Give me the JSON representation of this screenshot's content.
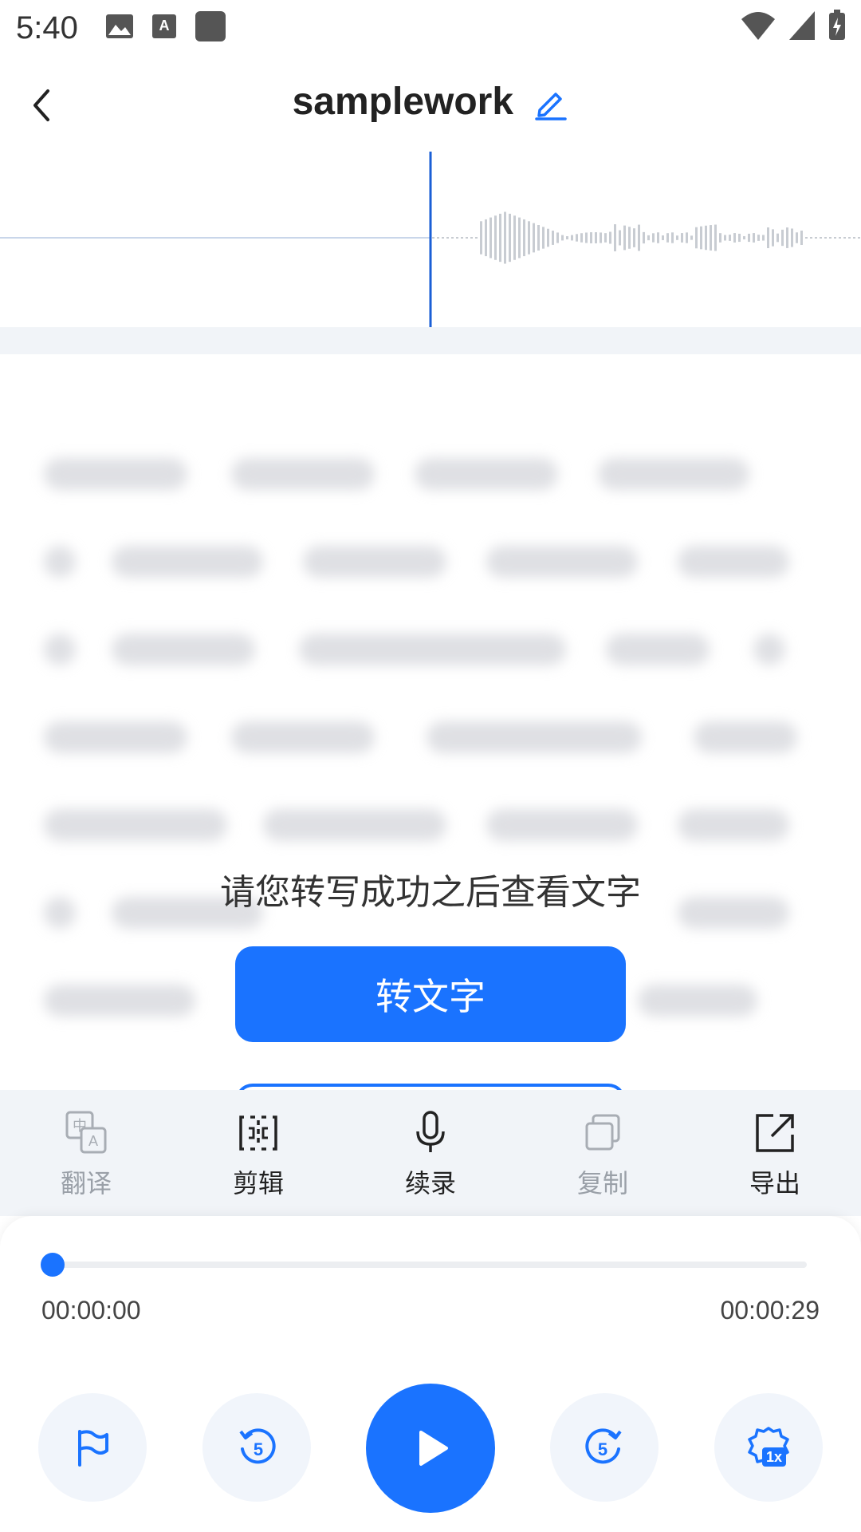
{
  "status_bar": {
    "time": "5:40"
  },
  "header": {
    "title": "samplework"
  },
  "placeholder": {
    "hint": "请您转写成功之后查看文字",
    "convert_label": "转文字"
  },
  "toolbar": {
    "items": [
      {
        "label": "翻译",
        "icon": "translate-icon",
        "enabled": false
      },
      {
        "label": "剪辑",
        "icon": "cut-icon",
        "enabled": true
      },
      {
        "label": "续录",
        "icon": "microphone-icon",
        "enabled": true
      },
      {
        "label": "复制",
        "icon": "copy-icon",
        "enabled": false
      },
      {
        "label": "导出",
        "icon": "export-icon",
        "enabled": true
      }
    ]
  },
  "player": {
    "current_time": "00:00:00",
    "total_time": "00:00:29",
    "progress": 0.0,
    "speed": "1x"
  },
  "colors": {
    "accent": "#1a73ff",
    "band": "#f1f4f8"
  }
}
